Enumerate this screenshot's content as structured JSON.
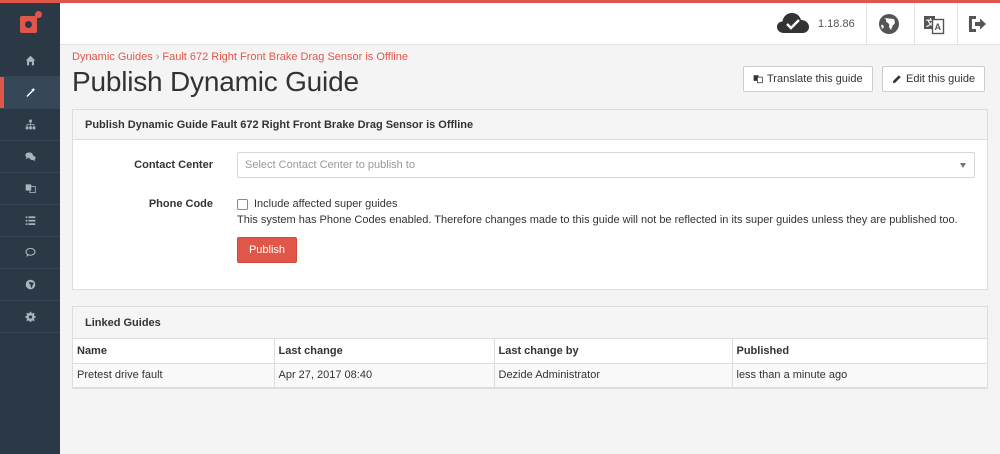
{
  "app": {
    "version": "1.18.86"
  },
  "sidebar": {
    "items": [
      {
        "icon": "home-icon"
      },
      {
        "icon": "magic-wand-icon",
        "active": true
      },
      {
        "icon": "sitemap-icon"
      },
      {
        "icon": "comments-icon"
      },
      {
        "icon": "translate-icon"
      },
      {
        "icon": "list-icon"
      },
      {
        "icon": "comment-icon"
      },
      {
        "icon": "globe-icon"
      },
      {
        "icon": "gear-icon"
      }
    ]
  },
  "topbar": {
    "icons": [
      "cloud-check-icon",
      "globe-icon",
      "translate-icon",
      "sign-out-icon"
    ]
  },
  "breadcrumb": {
    "parent": "Dynamic Guides",
    "separator": "›",
    "current": "Fault 672 Right Front Brake Drag Sensor is Offline"
  },
  "page": {
    "title": "Publish Dynamic Guide",
    "translate_button": "Translate this guide",
    "edit_button": "Edit this guide"
  },
  "publish_panel": {
    "heading": "Publish Dynamic Guide Fault 672 Right Front Brake Drag Sensor is Offline",
    "contact_center_label": "Contact Center",
    "contact_center_placeholder": "Select Contact Center to publish to",
    "phone_code_label": "Phone Code",
    "include_super_guides_label": "Include affected super guides",
    "include_super_guides_checked": false,
    "help_text": "This system has Phone Codes enabled. Therefore changes made to this guide will not be reflected in its super guides unless they are published too.",
    "publish_button": "Publish"
  },
  "linked_guides": {
    "heading": "Linked Guides",
    "columns": [
      "Name",
      "Last change",
      "Last change by",
      "Published"
    ],
    "rows": [
      [
        "Pretest drive fault",
        "Apr 27, 2017 08:40",
        "Dezide Administrator",
        "less than a minute ago"
      ]
    ]
  },
  "colors": {
    "accent": "#e0574a",
    "sidebar_bg": "#2b3947"
  }
}
